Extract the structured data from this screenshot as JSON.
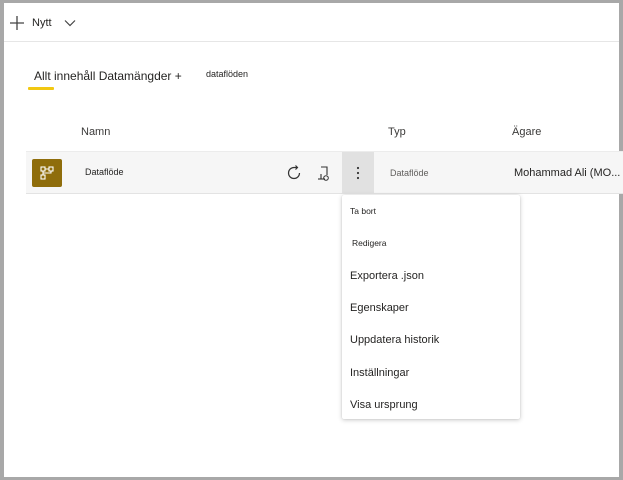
{
  "toolbar": {
    "new_label": "Nytt"
  },
  "tabs": {
    "all_content": "Allt innehåll Datamängder +",
    "dataflows": "dataflöden"
  },
  "table": {
    "headers": {
      "name": "Namn",
      "type": "Typ",
      "owner": "Ägare"
    },
    "rows": [
      {
        "icon": "dataflow-icon",
        "name": "Dataflöde",
        "type": "Dataflöde",
        "owner": "Mohammad Ali (MO..."
      }
    ]
  },
  "context_menu": {
    "items": [
      "Ta bort",
      "Redigera",
      "Exportera .json",
      "Egenskaper",
      "Uppdatera historik",
      "Inställningar",
      "Visa ursprung"
    ]
  },
  "colors": {
    "accent_tab": "#f2c811",
    "dataflow_icon_bg": "#8f6d0b",
    "row_bg": "#f6f6f6",
    "more_button_bg": "#e1e1e1"
  }
}
